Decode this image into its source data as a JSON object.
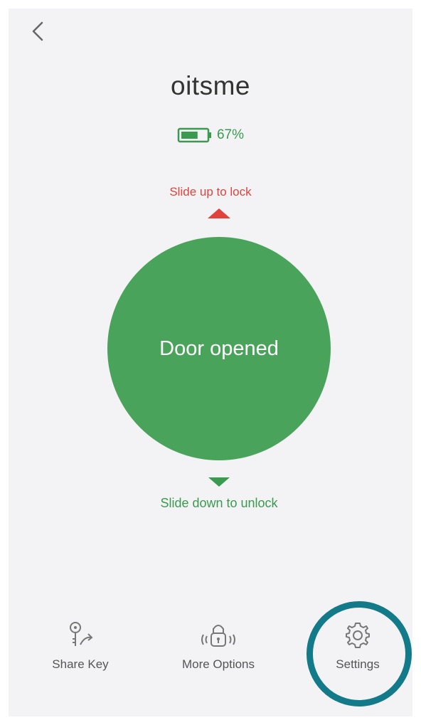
{
  "header": {
    "back_icon": "chevron-left-icon"
  },
  "device": {
    "name": "oitsme",
    "battery_percent_label": "67%",
    "battery_level": 0.67
  },
  "lock_control": {
    "lock_hint": "Slide up to lock",
    "status": "Door opened",
    "unlock_hint": "Slide down to unlock",
    "lock_color": "#e0433e",
    "open_color": "#4aa35a"
  },
  "bottom_nav": {
    "share_key": {
      "label": "Share Key",
      "icon": "key-share-icon"
    },
    "more_options": {
      "label": "More Options",
      "icon": "lock-options-icon"
    },
    "settings": {
      "label": "Settings",
      "icon": "gear-icon"
    }
  },
  "annotation": {
    "highlight_color": "#137a89",
    "highlighted_item": "settings"
  }
}
